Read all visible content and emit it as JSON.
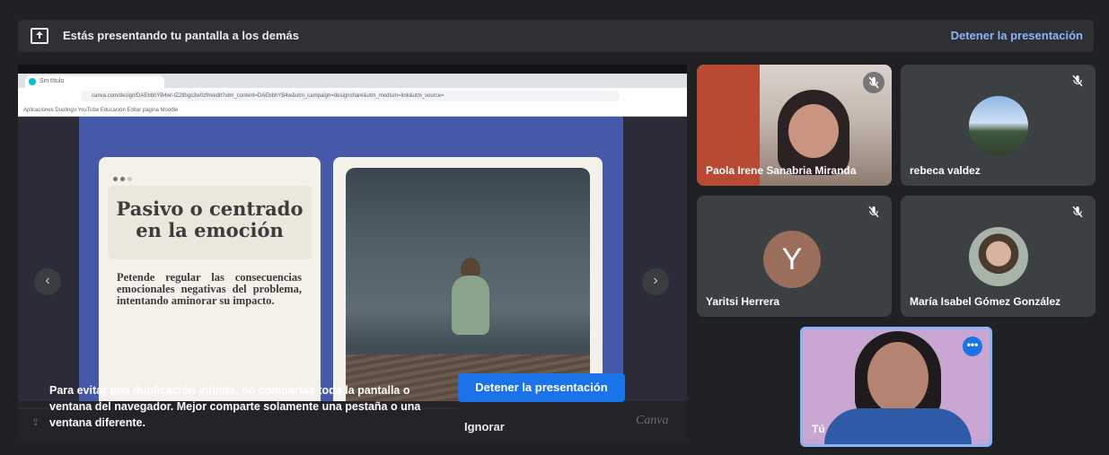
{
  "topbar": {
    "icon": "present-screen-icon",
    "message": "Estás presentando tu pantalla a los demás",
    "stop_link": "Detener la presentación"
  },
  "shared_screen": {
    "browser_tab_title": "Sin título",
    "address": "canva.com/design/DAEbbhYB4w/-tZ2tlbgs3w0zfm/edit?utm_content=DAEbbhYB4w&utm_campaign=designshare&utm_medium=link&utm_source=",
    "bookmarks": "Aplicaciones   Duolingo   YouTube   Educación   Editar página   Moodle",
    "slide": {
      "title": "Pasivo o centrado en la emoción",
      "body": "Petende regular las consecuencias emocionales negativas del problema, intentando aminorar su impacto."
    },
    "canva_watermark": "Canva"
  },
  "warning": {
    "text": "Para evitar una duplicación infinita, no compartas toda la pantalla o ventana del navegador. Mejor comparte solamente una pestaña o una ventana diferente.",
    "stop_button": "Detener la presentación",
    "ignore_button": "Ignorar"
  },
  "participants": [
    {
      "name": "Paola Irene Sanabria Miranda",
      "muted": true,
      "avatar": "video"
    },
    {
      "name": "rebeca valdez",
      "muted": true,
      "avatar": "photo"
    },
    {
      "name": "Yaritsi Herrera",
      "muted": true,
      "avatar_letter": "Y",
      "avatar_color": "#9b6e5c"
    },
    {
      "name": "María Isabel Gómez González",
      "muted": true,
      "avatar": "photo"
    }
  ],
  "self": {
    "name": "Tú",
    "more_icon": "more-options-icon"
  },
  "colors": {
    "background": "#202124",
    "accent": "#8ab4f8",
    "primary_button": "#1a73e8"
  }
}
